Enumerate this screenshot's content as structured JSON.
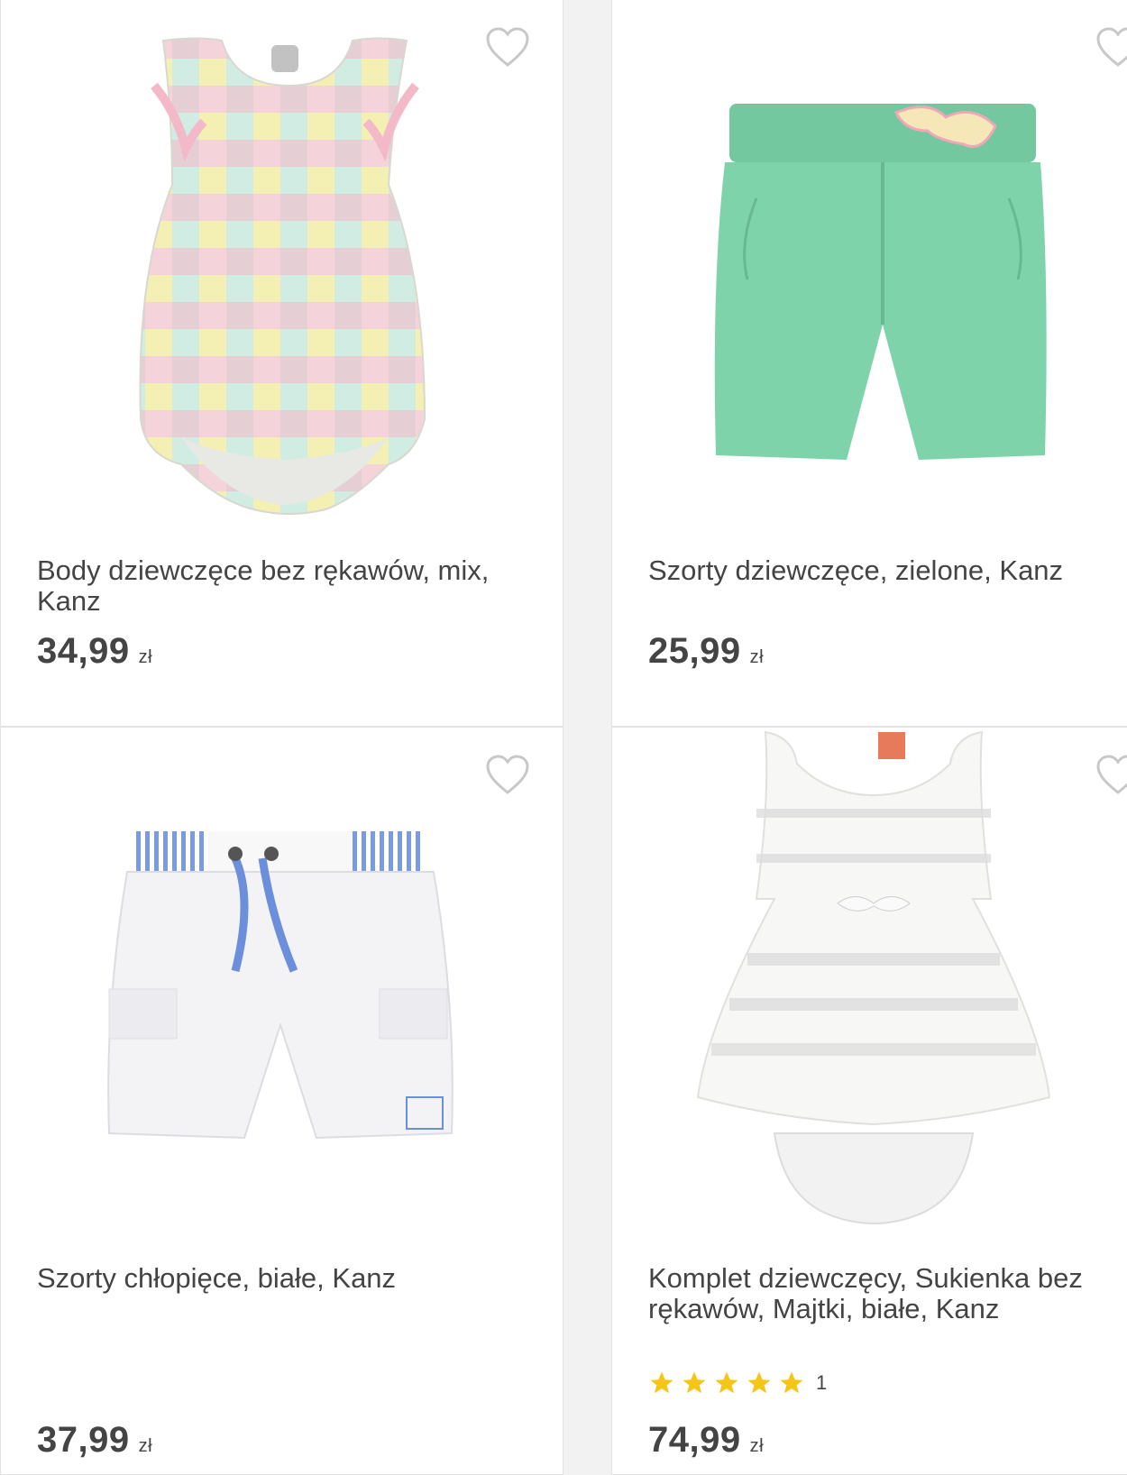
{
  "products": [
    {
      "title": "Body dziewczęce bez rękawów, mix, Kanz",
      "price": "34,99",
      "currency": "zł",
      "image_icon": "gingham-bodysuit"
    },
    {
      "title": "Szorty dziewczęce, zielone, Kanz",
      "price": "25,99",
      "currency": "zł",
      "image_icon": "green-shorts"
    },
    {
      "title": "Szorty chłopięce, białe, Kanz",
      "price": "37,99",
      "currency": "zł",
      "image_icon": "white-shorts"
    },
    {
      "title": "Komplet dziewczęcy, Sukienka bez rękawów, Majtki, białe, Kanz",
      "price": "74,99",
      "currency": "zł",
      "rating_count": "1",
      "rating": 5,
      "image_icon": "white-dress-set"
    }
  ],
  "colors": {
    "star": "#f5c518",
    "heart_outline": "#c8c8c8",
    "text": "#444444"
  }
}
